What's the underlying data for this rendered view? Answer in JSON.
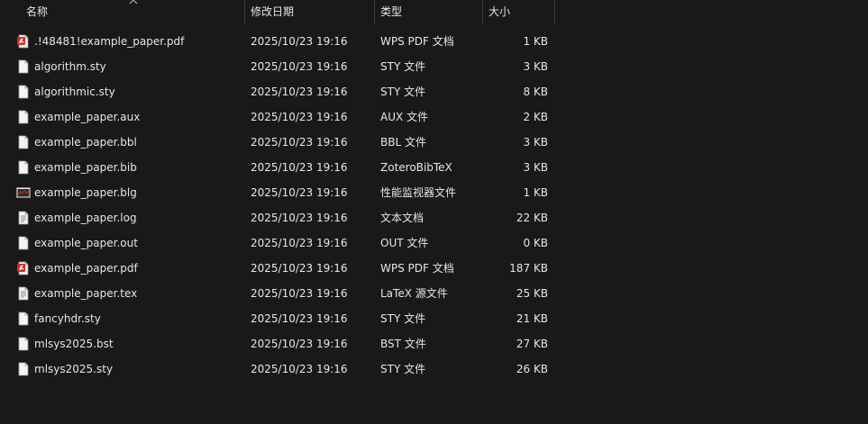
{
  "columns": {
    "name": "名称",
    "modified": "修改日期",
    "type": "类型",
    "size": "大小"
  },
  "files": [
    {
      "name": ".!48481!example_paper.pdf",
      "modified": "2025/10/23 19:16",
      "type": "WPS PDF 文档",
      "size": "1 KB",
      "icon": "pdf-icon"
    },
    {
      "name": "algorithm.sty",
      "modified": "2025/10/23 19:16",
      "type": "STY 文件",
      "size": "3 KB",
      "icon": "file-icon"
    },
    {
      "name": "algorithmic.sty",
      "modified": "2025/10/23 19:16",
      "type": "STY 文件",
      "size": "8 KB",
      "icon": "file-icon"
    },
    {
      "name": "example_paper.aux",
      "modified": "2025/10/23 19:16",
      "type": "AUX 文件",
      "size": "2 KB",
      "icon": "file-icon"
    },
    {
      "name": "example_paper.bbl",
      "modified": "2025/10/23 19:16",
      "type": "BBL 文件",
      "size": "3 KB",
      "icon": "file-icon"
    },
    {
      "name": "example_paper.bib",
      "modified": "2025/10/23 19:16",
      "type": "ZoteroBibTeX",
      "size": "3 KB",
      "icon": "file-icon"
    },
    {
      "name": "example_paper.blg",
      "modified": "2025/10/23 19:16",
      "type": "性能监视器文件",
      "size": "1 KB",
      "icon": "performance-monitor-icon"
    },
    {
      "name": "example_paper.log",
      "modified": "2025/10/23 19:16",
      "type": "文本文档",
      "size": "22 KB",
      "icon": "text-document-icon"
    },
    {
      "name": "example_paper.out",
      "modified": "2025/10/23 19:16",
      "type": "OUT 文件",
      "size": "0 KB",
      "icon": "file-icon"
    },
    {
      "name": "example_paper.pdf",
      "modified": "2025/10/23 19:16",
      "type": "WPS PDF 文档",
      "size": "187 KB",
      "icon": "pdf-icon"
    },
    {
      "name": "example_paper.tex",
      "modified": "2025/10/23 19:16",
      "type": "LaTeX 源文件",
      "size": "25 KB",
      "icon": "text-document-icon"
    },
    {
      "name": "fancyhdr.sty",
      "modified": "2025/10/23 19:16",
      "type": "STY 文件",
      "size": "21 KB",
      "icon": "file-icon"
    },
    {
      "name": "mlsys2025.bst",
      "modified": "2025/10/23 19:16",
      "type": "BST 文件",
      "size": "27 KB",
      "icon": "file-icon"
    },
    {
      "name": "mlsys2025.sty",
      "modified": "2025/10/23 19:16",
      "type": "STY 文件",
      "size": "26 KB",
      "icon": "file-icon"
    }
  ],
  "colors": {
    "background": "#191919",
    "text": "#e6e6e6",
    "pdf_red": "#d9291c"
  }
}
